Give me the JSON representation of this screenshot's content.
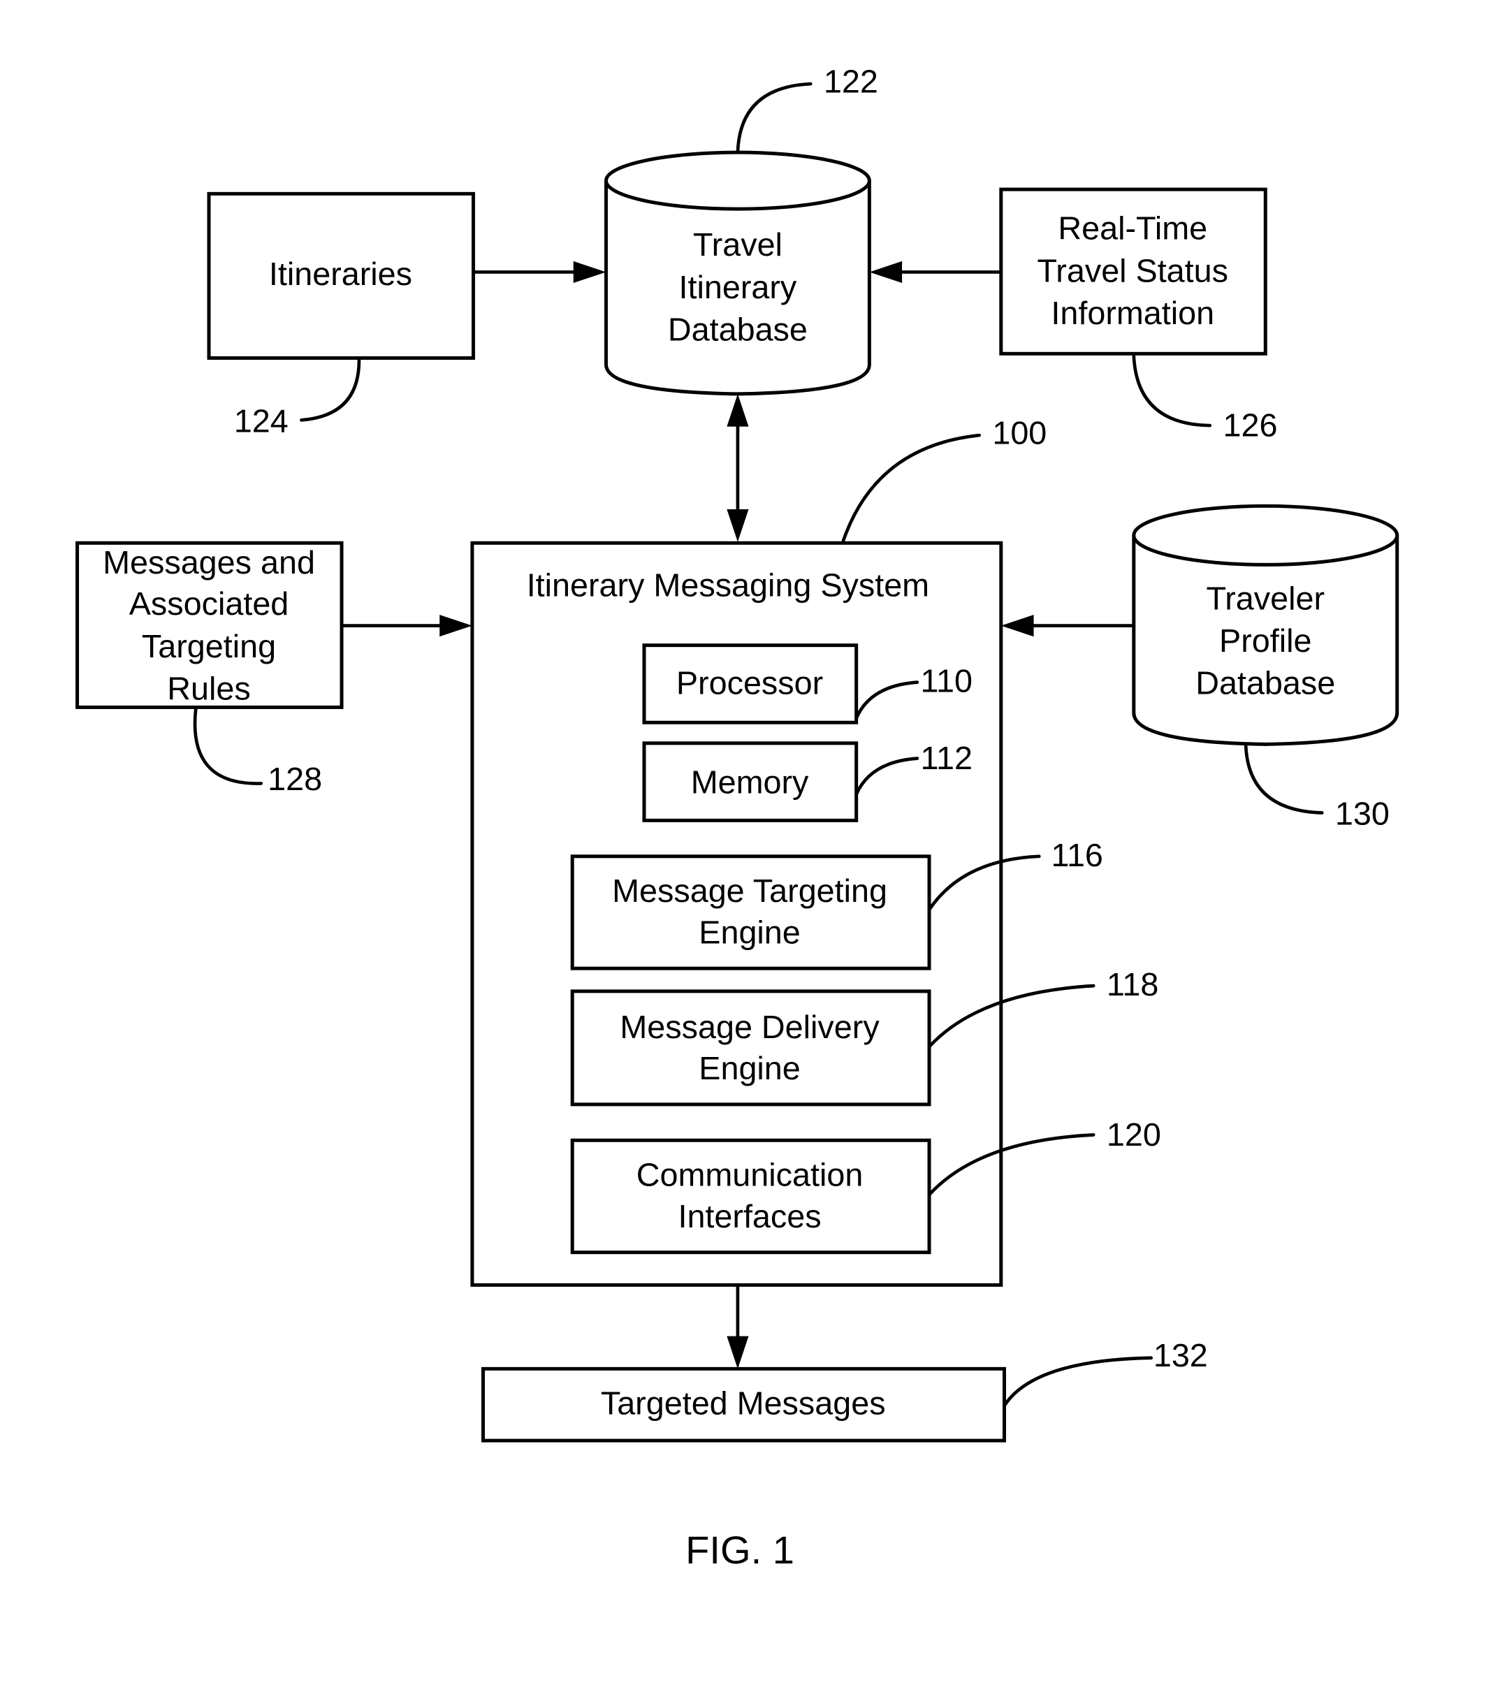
{
  "figure": {
    "caption": "FIG. 1",
    "system": {
      "title": "Itinerary Messaging System",
      "ref": "100",
      "components": [
        {
          "lines": [
            "Processor"
          ],
          "ref": "110"
        },
        {
          "lines": [
            "Memory"
          ],
          "ref": "112"
        },
        {
          "lines": [
            "Message Targeting",
            "Engine"
          ],
          "ref": "116"
        },
        {
          "lines": [
            "Message Delivery",
            "Engine"
          ],
          "ref": "118"
        },
        {
          "lines": [
            "Communication",
            "Interfaces"
          ],
          "ref": "120"
        }
      ]
    },
    "travel_db": {
      "lines": [
        "Travel",
        "Itinerary",
        "Database"
      ],
      "ref": "122"
    },
    "itineraries": {
      "lines": [
        "Itineraries"
      ],
      "ref": "124"
    },
    "realtime": {
      "lines": [
        "Real-Time",
        "Travel Status",
        "Information"
      ],
      "ref": "126"
    },
    "messages_rules": {
      "lines": [
        "Messages and",
        "Associated",
        "Targeting",
        "Rules"
      ],
      "ref": "128"
    },
    "traveler_db": {
      "lines": [
        "Traveler",
        "Profile",
        "Database"
      ],
      "ref": "130"
    },
    "targeted_messages": {
      "lines": [
        "Targeted Messages"
      ],
      "ref": "132"
    }
  }
}
